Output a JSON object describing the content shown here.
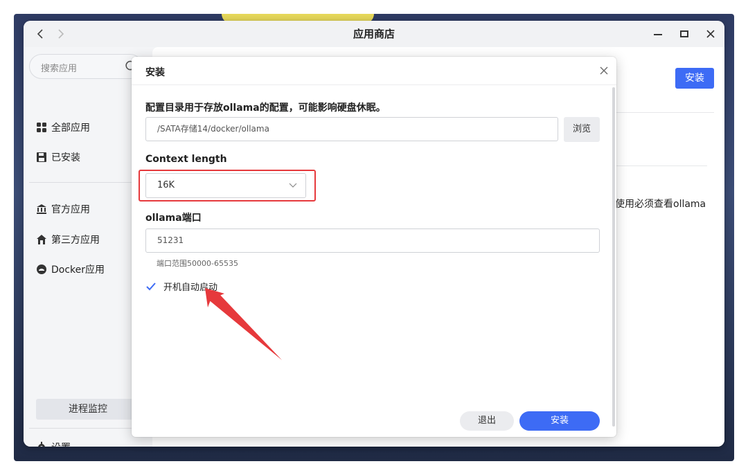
{
  "window": {
    "title": "应用商店"
  },
  "sidebar": {
    "search_placeholder": "搜索应用",
    "items": [
      {
        "label": "全部应用",
        "icon": "grid-icon"
      },
      {
        "label": "已安装",
        "icon": "save-disk-icon"
      },
      {
        "label": "官方应用",
        "icon": "bank-icon"
      },
      {
        "label": "第三方应用",
        "icon": "house-icon"
      },
      {
        "label": "Docker应用",
        "icon": "docker-icon"
      }
    ],
    "monitor_label": "进程监控",
    "settings_label": "设置"
  },
  "background": {
    "install_label": "安装",
    "snippet": "使用必须查看ollama"
  },
  "dialog": {
    "title": "安装",
    "config_label": "配置目录用于存放ollama的配置，可能影响硬盘休眠。",
    "config_path": "/SATA存储14/docker/ollama",
    "browse_label": "浏览",
    "context_label": "Context length",
    "context_value": "16K",
    "port_label": "ollama端口",
    "port_value": "51231",
    "port_hint": "端口范围50000-65535",
    "autostart_label": "开机自动启动",
    "autostart_checked": true,
    "cancel_label": "退出",
    "install_label": "安装"
  },
  "colors": {
    "accent": "#3d6bf5",
    "annotation": "#e6393c"
  }
}
